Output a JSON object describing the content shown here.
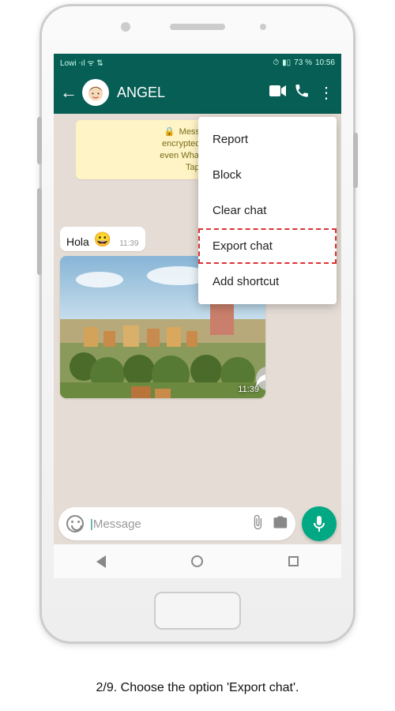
{
  "statusbar": {
    "carrier": "Lowi",
    "battery_pct": "73 %",
    "time": "10:56"
  },
  "header": {
    "contact_name": "ANGEL"
  },
  "chat": {
    "date_chip": "",
    "encryption_banner": "Messages and calls are end-to-end encrypted. No one outside of this chat, not even WhatsApp, can read or listen to them. Tap to learn more.",
    "encryption_banner_truncated": "Messages an\nencrypted. No one\neven WhatsApp, ca\nTap to",
    "messages": [
      {
        "type": "text",
        "text": "Hola",
        "emoji": "😀",
        "time": "11:39"
      },
      {
        "type": "image",
        "time": "11:39"
      }
    ]
  },
  "menu": {
    "items": [
      {
        "label": "Report",
        "highlight": false
      },
      {
        "label": "Block",
        "highlight": false
      },
      {
        "label": "Clear chat",
        "highlight": false
      },
      {
        "label": "Export chat",
        "highlight": true
      },
      {
        "label": "Add shortcut",
        "highlight": false
      }
    ]
  },
  "input": {
    "placeholder": "Message"
  },
  "caption": "2/9. Choose the option 'Export chat'."
}
